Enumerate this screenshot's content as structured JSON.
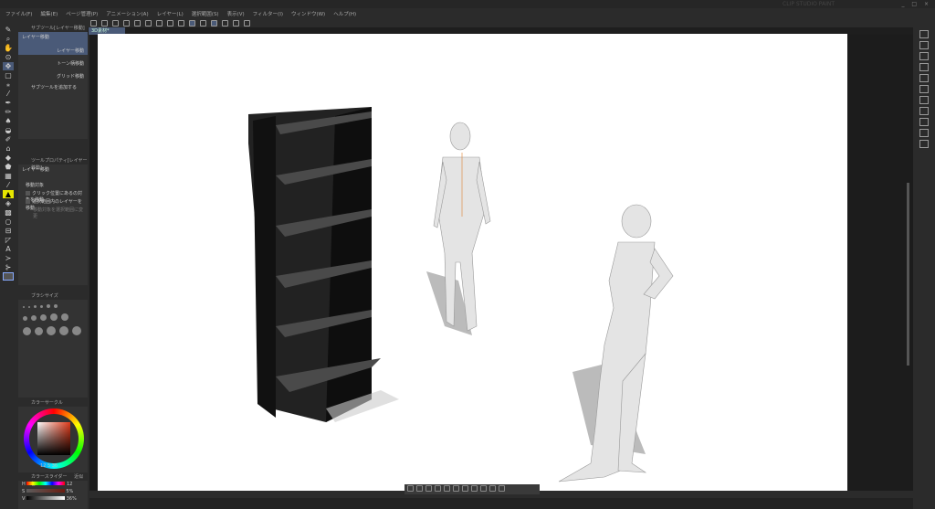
{
  "window": {
    "title": "CLIP STUDIO PAINT",
    "controls": "_ □ ×"
  },
  "menu": [
    "ファイル(F)",
    "編集(E)",
    "ページ管理(P)",
    "アニメーション(A)",
    "レイヤー(L)",
    "選択範囲(S)",
    "表示(V)",
    "フィルター(I)",
    "ウィンドウ(W)",
    "ヘルプ(H)"
  ],
  "document_tab": "3D素材*",
  "subtool_panel": {
    "title": "サブツール[レイヤー移動]",
    "items": [
      "レイヤー移動",
      "レイヤー移動",
      "トーン柄移動",
      "グリッド移動"
    ],
    "add": "サブツールを追加する"
  },
  "tool_property": {
    "title": "ツールプロパティ[レイヤー移動]",
    "tool_name": "レイヤー移動",
    "target_label": "移動対象",
    "options": [
      "クリック位置にあるの対象を移動",
      "選択範囲内のレイヤーを移動"
    ],
    "hint": "移動対象を選択範囲に変更"
  },
  "brush_size": {
    "title": "ブラシサイズ"
  },
  "color_wheel": {
    "title": "カラーサークル",
    "h": "12",
    "s": "5",
    "v": "36",
    "hue_color": "#e03a1a"
  },
  "color_slider": {
    "title": "カラースライダー",
    "tab2": "近似色",
    "rows": [
      {
        "label": "H",
        "value": "12"
      },
      {
        "label": "S",
        "value": "5%"
      },
      {
        "label": "V",
        "value": "36%"
      }
    ]
  }
}
